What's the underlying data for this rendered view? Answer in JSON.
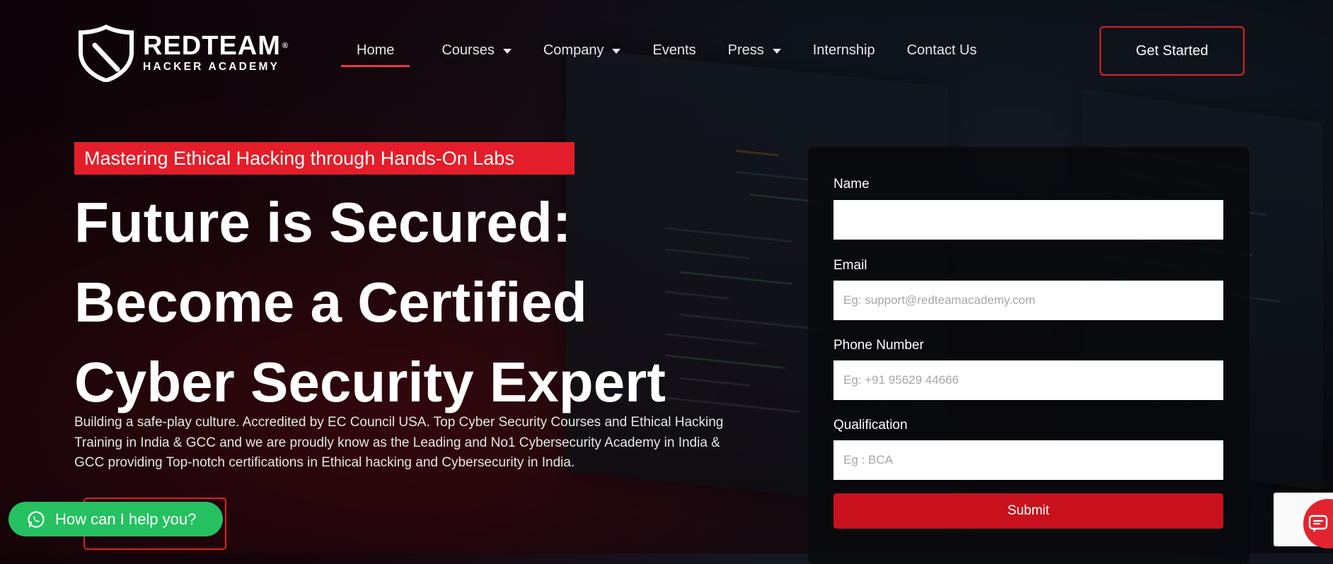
{
  "brand": {
    "name": "REDTEAM",
    "registered": "®",
    "subtitle": "HACKER ACADEMY"
  },
  "nav": {
    "items": [
      {
        "label": "Home",
        "active": true,
        "dropdown": false
      },
      {
        "label": "Courses",
        "active": false,
        "dropdown": true
      },
      {
        "label": "Company",
        "active": false,
        "dropdown": true
      },
      {
        "label": "Events",
        "active": false,
        "dropdown": false
      },
      {
        "label": "Press",
        "active": false,
        "dropdown": true
      },
      {
        "label": "Internship",
        "active": false,
        "dropdown": false
      },
      {
        "label": "Contact Us",
        "active": false,
        "dropdown": false
      }
    ],
    "cta_label": "Get Started"
  },
  "hero": {
    "tagline": "Mastering Ethical Hacking through Hands-On Labs",
    "headline_lines": [
      "Future is Secured:",
      "Become a Certified",
      "Cyber Security Expert"
    ],
    "description_lines": [
      "Building a safe-play culture. Accredited by EC Council USA. Top Cyber Security Courses and Ethical Hacking",
      "Training in India & GCC and we are proudly know as the Leading and No1 Cybersecurity Academy in India &",
      "GCC providing Top-notch certifications in Ethical hacking and Cybersecurity in India."
    ]
  },
  "form": {
    "fields": [
      {
        "label": "Name",
        "placeholder": "",
        "value": ""
      },
      {
        "label": "Email",
        "placeholder": "Eg: support@redteamacademy.com",
        "value": ""
      },
      {
        "label": "Phone Number",
        "placeholder": "Eg: +91 95629 44666",
        "value": ""
      },
      {
        "label": "Qualification",
        "placeholder": "Eg : BCA",
        "value": ""
      }
    ],
    "submit_label": "Submit"
  },
  "whatsapp": {
    "label": "How can I help you?"
  },
  "colors": {
    "accent": "#e31e2a",
    "submit": "#c8111c",
    "whatsapp": "#25c160"
  }
}
